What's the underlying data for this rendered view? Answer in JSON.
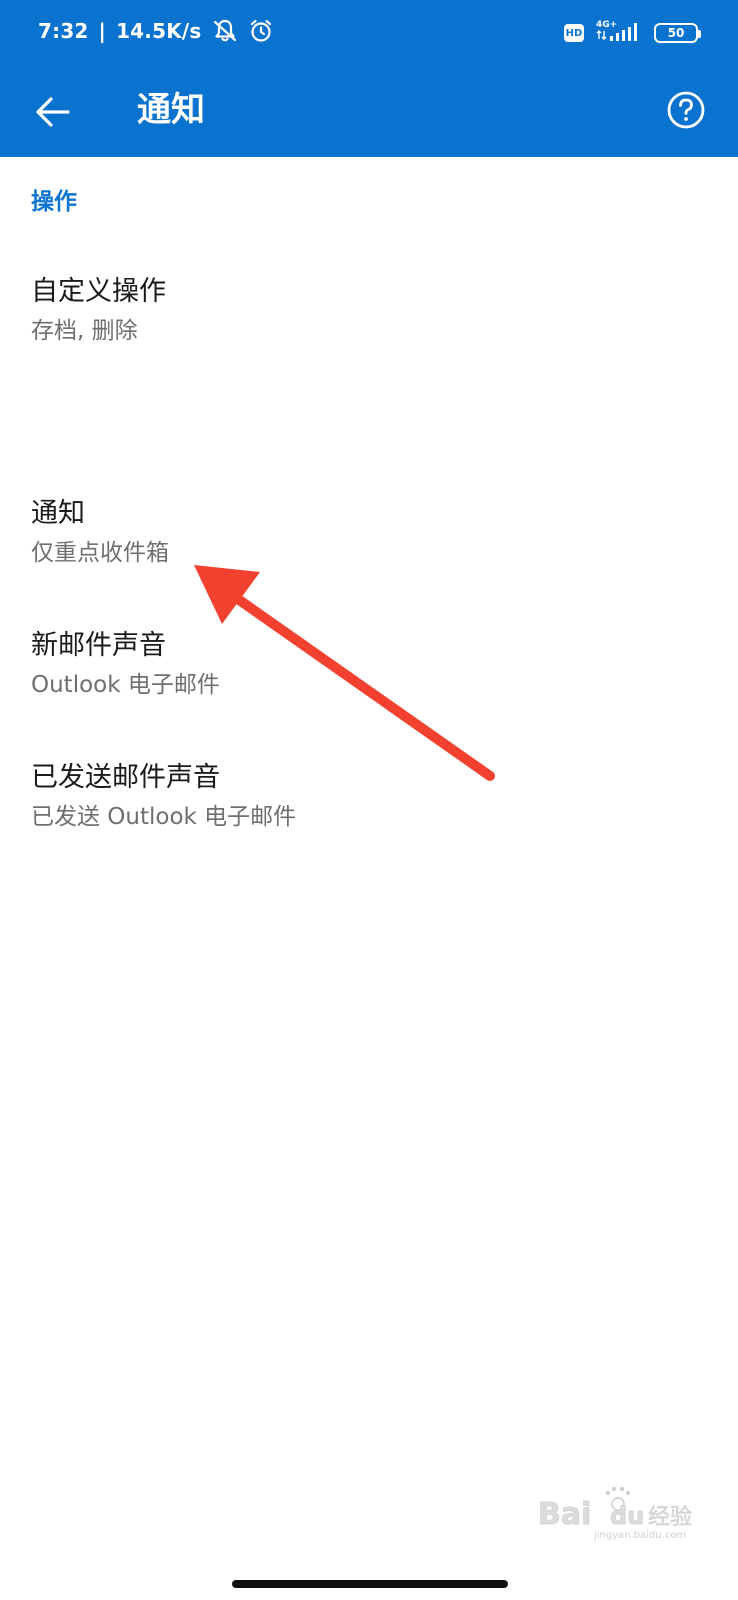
{
  "status_bar": {
    "time": "7:32",
    "separator": "|",
    "net_speed": "14.5K/s",
    "hd_label": "HD",
    "network_type": "4G+",
    "battery_level": "50"
  },
  "app_bar": {
    "title": "通知"
  },
  "sections": [
    {
      "header": "操作",
      "items": [
        {
          "title": "自定义操作",
          "subtitle": "存档, 删除"
        },
        {
          "title": "通知",
          "subtitle": "仅重点收件箱"
        },
        {
          "title": "新邮件声音",
          "subtitle": "Outlook 电子邮件"
        },
        {
          "title": "已发送邮件声音",
          "subtitle": "已发送 Outlook 电子邮件"
        }
      ]
    }
  ],
  "watermark": {
    "text_latin_1": "Bai",
    "text_latin_2": "du",
    "text_cn": "经验",
    "url": "jingyan.baidu.com"
  },
  "colors": {
    "primary": "#0A73D0",
    "annotation_arrow": "#F2412E"
  }
}
